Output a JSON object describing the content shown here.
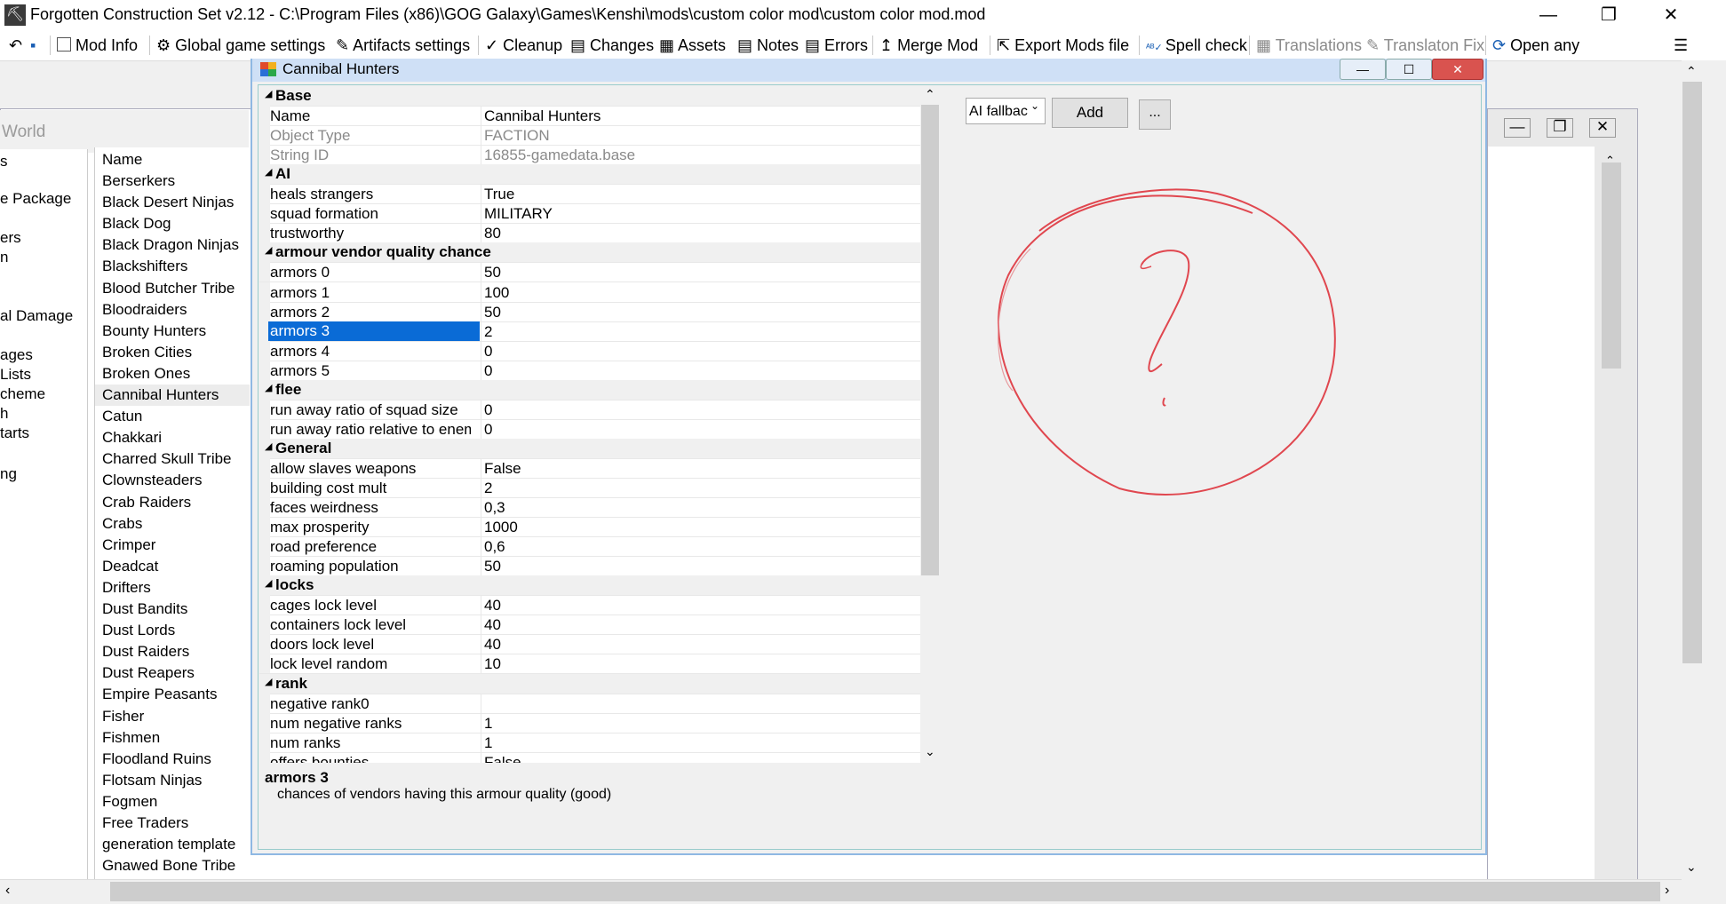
{
  "window": {
    "title": "Forgotten Construction Set v2.12 - C:\\Program Files (x86)\\GOG Galaxy\\Games\\Kenshi\\mods\\custom color mod\\custom color mod.mod"
  },
  "toolbar": [
    {
      "label": "Mod Info"
    },
    {
      "label": "Global game settings"
    },
    {
      "label": "Artifacts settings"
    },
    {
      "label": "Cleanup"
    },
    {
      "label": "Changes"
    },
    {
      "label": "Assets"
    },
    {
      "label": "Notes"
    },
    {
      "label": "Errors"
    },
    {
      "label": "Merge Mod"
    },
    {
      "label": "Export Mods file"
    },
    {
      "label": "Spell check"
    },
    {
      "label": "Translations"
    },
    {
      "label": "Translaton Fix"
    },
    {
      "label": "Open any"
    }
  ],
  "background": {
    "world_label": "World",
    "left_items": [
      "s",
      "e Package",
      "ers",
      "n",
      "",
      "al Damage",
      "",
      "ages",
      "Lists",
      "cheme",
      "h",
      "tarts",
      "",
      "ng"
    ],
    "name_header": "Name",
    "names": [
      "Berserkers",
      "Black Desert Ninjas",
      "Black Dog",
      "Black Dragon Ninjas",
      "Blackshifters",
      "Blood Butcher Tribe",
      "Bloodraiders",
      "Bounty Hunters",
      "Broken Cities",
      "Broken Ones",
      "Cannibal Hunters",
      "Catun",
      "Chakkari",
      "Charred Skull Tribe",
      "Clownsteaders",
      "Crab Raiders",
      "Crabs",
      "Crimper",
      "Deadcat",
      "Drifters",
      "Dust Bandits",
      "Dust Lords",
      "Dust Raiders",
      "Dust Reapers",
      "Empire Peasants",
      "Fisher",
      "Fishmen",
      "Floodland Ruins",
      "Flotsam Ninjas",
      "Fogmen",
      "Free Traders",
      "generation template",
      "Gnawed Bone Tribe"
    ],
    "selected_name": "Cannibal Hunters"
  },
  "editor": {
    "title": "Cannibal Hunters",
    "rows": [
      {
        "type": "cat",
        "label": "Base"
      },
      {
        "type": "prop",
        "key": "Name",
        "value": "Cannibal Hunters"
      },
      {
        "type": "prop",
        "key": "Object Type",
        "value": "FACTION",
        "readonly": true
      },
      {
        "type": "prop",
        "key": "String ID",
        "value": "16855-gamedata.base",
        "readonly": true
      },
      {
        "type": "cat",
        "label": "AI"
      },
      {
        "type": "prop",
        "key": "heals strangers",
        "value": "True"
      },
      {
        "type": "prop",
        "key": "squad formation",
        "value": "MILITARY"
      },
      {
        "type": "prop",
        "key": "trustworthy",
        "value": "80"
      },
      {
        "type": "cat",
        "label": "armour vendor quality chance"
      },
      {
        "type": "prop",
        "key": "armors 0",
        "value": "50"
      },
      {
        "type": "prop",
        "key": "armors 1",
        "value": "100"
      },
      {
        "type": "prop",
        "key": "armors 2",
        "value": "50"
      },
      {
        "type": "prop",
        "key": "armors 3",
        "value": "2",
        "selected": true
      },
      {
        "type": "prop",
        "key": "armors 4",
        "value": "0"
      },
      {
        "type": "prop",
        "key": "armors 5",
        "value": "0"
      },
      {
        "type": "cat",
        "label": "flee"
      },
      {
        "type": "prop",
        "key": "run away ratio of squad size",
        "value": "0"
      },
      {
        "type": "prop",
        "key": "run away ratio relative to enemy",
        "value": "0"
      },
      {
        "type": "cat",
        "label": "General"
      },
      {
        "type": "prop",
        "key": "allow slaves weapons",
        "value": "False"
      },
      {
        "type": "prop",
        "key": "building cost mult",
        "value": "2"
      },
      {
        "type": "prop",
        "key": "faces weirdness",
        "value": "0,3"
      },
      {
        "type": "prop",
        "key": "max prosperity",
        "value": "1000"
      },
      {
        "type": "prop",
        "key": "road preference",
        "value": "0,6"
      },
      {
        "type": "prop",
        "key": "roaming population",
        "value": "50"
      },
      {
        "type": "cat",
        "label": "locks"
      },
      {
        "type": "prop",
        "key": "cages lock level",
        "value": "40"
      },
      {
        "type": "prop",
        "key": "containers lock level",
        "value": "40"
      },
      {
        "type": "prop",
        "key": "doors lock level",
        "value": "40"
      },
      {
        "type": "prop",
        "key": "lock level random",
        "value": "10"
      },
      {
        "type": "cat",
        "label": "rank"
      },
      {
        "type": "prop",
        "key": "negative rank0",
        "value": ""
      },
      {
        "type": "prop",
        "key": "num negative ranks",
        "value": "1"
      },
      {
        "type": "prop",
        "key": "num ranks",
        "value": "1"
      },
      {
        "type": "prop",
        "key": "offers bounties",
        "value": "False"
      }
    ],
    "description_title": "armors 3",
    "description_text": "chances of vendors having this armour quality (good)",
    "ai_select_value": "AI fallbac",
    "add_label": "Add",
    "more_label": "..."
  },
  "colors": {
    "selection": "#0a6bd6",
    "doodle": "#e0474f"
  }
}
